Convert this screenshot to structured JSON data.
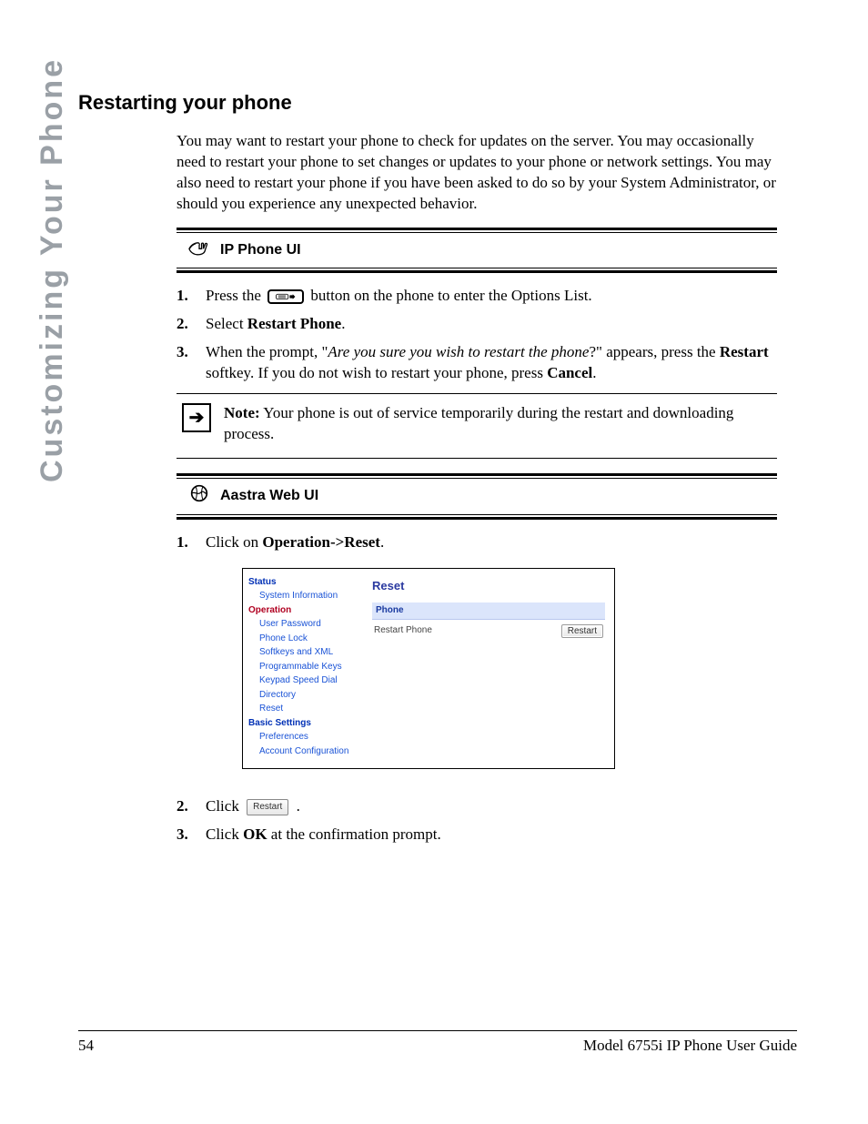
{
  "sideTab": "Customizing Your Phone",
  "heading": "Restarting your phone",
  "intro": "You may want to restart your phone to check for updates on the server. You may occasionally need to restart your phone to set changes or updates to your phone or network settings.   You may also need to restart your phone if you have been asked to do so by your System Administrator, or should you experience any unexpected behavior.",
  "sectionA": {
    "title": "IP Phone UI",
    "steps": {
      "s1_num": "1.",
      "s1_a": "Press the ",
      "s1_b": " button on the phone to enter the Options List.",
      "s2_num": "2.",
      "s2_a": "Select ",
      "s2_b": "Restart Phone",
      "s2_c": ".",
      "s3_num": "3.",
      "s3_a": "When the prompt, \"",
      "s3_b": "Are you sure you wish to restart the phone",
      "s3_c": "?\" appears, press the ",
      "s3_d": "Restart",
      "s3_e": " softkey. If you do not wish to restart your phone, press ",
      "s3_f": "Cancel",
      "s3_g": "."
    }
  },
  "note": {
    "label": "Note:",
    "text": " Your phone is out of service temporarily during the restart and downloading process."
  },
  "sectionB": {
    "title": "Aastra Web UI",
    "s1_num": "1.",
    "s1_a": "Click on ",
    "s1_b": "Operation->Reset",
    "s1_c": ".",
    "s2_num": "2.",
    "s2_a": "Click ",
    "s2_btn": "Restart",
    "s2_c": ".",
    "s3_num": "3.",
    "s3_a": "Click ",
    "s3_b": "OK",
    "s3_c": " at the confirmation prompt."
  },
  "webui": {
    "nav": {
      "status": "Status",
      "status_items": [
        "System Information"
      ],
      "operation": "Operation",
      "operation_items": [
        "User Password",
        "Phone Lock",
        "Softkeys and XML",
        "Programmable Keys",
        "Keypad Speed Dial",
        "Directory",
        "Reset"
      ],
      "basic": "Basic Settings",
      "basic_items": [
        "Preferences",
        "Account Configuration"
      ]
    },
    "main": {
      "title": "Reset",
      "fieldHeader": "Phone",
      "rowLabel": "Restart Phone",
      "buttonLabel": "Restart"
    }
  },
  "footer": {
    "pageNum": "54",
    "title": "Model 6755i IP Phone User Guide"
  }
}
